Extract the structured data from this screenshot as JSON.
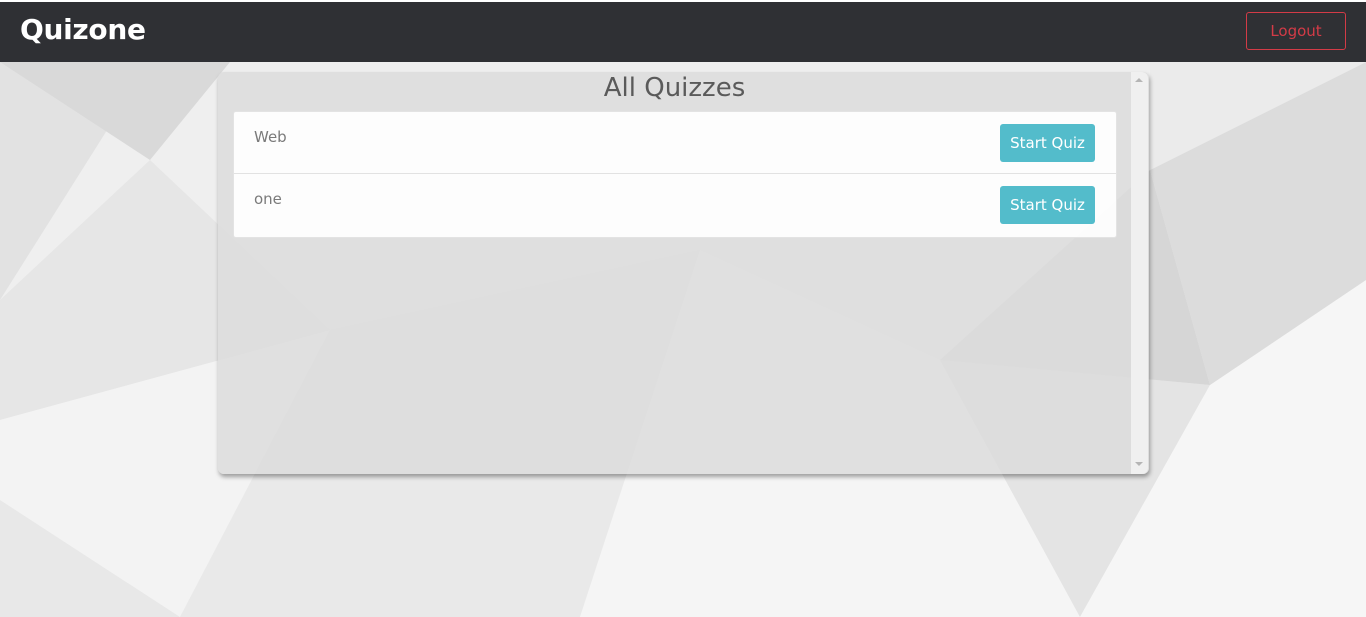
{
  "app": {
    "brand": "Quizone",
    "logout_label": "Logout"
  },
  "colors": {
    "navbar": "#2f3034",
    "logout_accent": "#d33b47",
    "start_button": "#53bccb"
  },
  "quizzes_panel": {
    "title": "All Quizzes",
    "items": [
      {
        "name": "Web",
        "action_label": "Start Quiz"
      },
      {
        "name": "one",
        "action_label": "Start Quiz"
      }
    ]
  }
}
